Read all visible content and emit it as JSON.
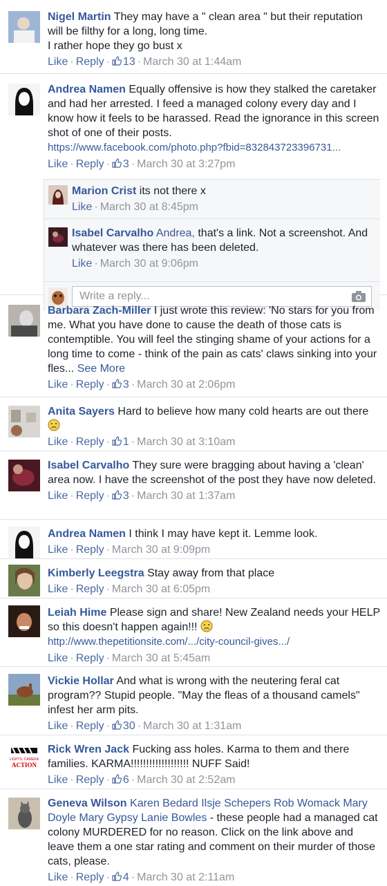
{
  "comments": [
    {
      "author": "Nigel Martin",
      "text": "They may have a \" clean area \" but their reputation will be filthy for a long, long time.",
      "text2": "I rather hope they go bust x",
      "likes": "13",
      "time": "March 30 at 1:44am"
    },
    {
      "author": "Andrea Namen",
      "text": "Equally offensive is how they stalked the caretaker and had her arrested. I feed a managed colony every day and I know how it feels to be harassed. Read the ignorance in this screen shot of one of their posts.",
      "link": "https://www.facebook.com/photo.php?fbid=832843723396731...",
      "likes": "3",
      "time": "March 30 at 3:27pm",
      "replies": [
        {
          "author": "Marion Crist",
          "text": "its not there x",
          "time": "March 30 at 8:45pm"
        },
        {
          "author": "Isabel Carvalho",
          "tag": "Andrea,",
          "text": "that's a link. Not a screenshot. And whatever was there has been deleted.",
          "time": "March 30 at 9:06pm"
        }
      ],
      "reply_placeholder": "Write a reply..."
    },
    {
      "author": "Barbara Zach-Miller",
      "text": "I just wrote this review: 'No stars for you from me. What you have done to cause the death of those cats is contemptible. You will feel the stinging shame of your actions for a long time to come - think of the pain as cats' claws sinking into your fles...",
      "see_more": "See More",
      "likes": "3",
      "time": "March 30 at 2:06pm"
    },
    {
      "author": "Anita Sayers",
      "text": "Hard to believe how many cold hearts are out there",
      "likes": "1",
      "time": "March 30 at 3:10am"
    },
    {
      "author": "Isabel Carvalho",
      "text": "They sure were bragging about having a 'clean' area now. I have the screenshot of the post they have now deleted.",
      "likes": "3",
      "time": "March 30 at 1:37am"
    },
    {
      "author": "Andrea Namen",
      "text": "I think I may have kept it. Lemme look.",
      "time": "March 30 at 9:09pm"
    },
    {
      "author": "Kimberly Leegstra",
      "text": "Stay away from that place",
      "time": "March 30 at 6:05pm"
    },
    {
      "author": "Leiah Hime",
      "text": "Please sign and share! New Zealand needs your HELP so this doesn't happen again!!!",
      "link": "http://www.thepetitionsite.com/.../city-council-gives.../",
      "time": "March 30 at 5:45am"
    },
    {
      "author": "Vickie Hollar",
      "text": "And what is wrong with the neutering feral cat program?? Stupid people. \"May the fleas of a thousand camels\" infest her arm pits.",
      "likes": "30",
      "time": "March 30 at 1:31am"
    },
    {
      "author": "Rick Wren Jack",
      "text": "Fucking ass holes. Karma to them and there families. KARMA!!!!!!!!!!!!!!!!!!! NUFF Said!",
      "likes": "6",
      "time": "March 30 at 2:52am",
      "avatar_text1": "LIGHTS, CAMERA",
      "avatar_text2": "ACTION"
    },
    {
      "author": "Geneva Wilson",
      "tags": "Karen Bedard Ilsje Schepers Rob Womack Mary Doyle Mary Gypsy Lanie Bowles",
      "text": "- these people had a managed cat colony MURDERED for no reason. Click on the link above and leave them a one star rating and comment on their murder of those cats, please.",
      "likes": "4",
      "time": "March 30 at 2:11am"
    }
  ],
  "ui": {
    "like": "Like",
    "reply": "Reply",
    "dot": "·"
  },
  "colors": {
    "link": "#365899",
    "meta": "#90949c",
    "border": "#dfe1e6"
  }
}
